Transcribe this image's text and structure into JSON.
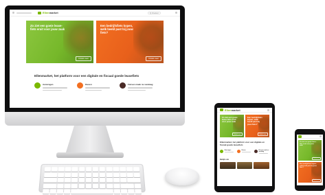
{
  "site": {
    "logo_prefix": "Ellen",
    "logo_suffix": "market",
    "search_placeholder": "Q Zoeken"
  },
  "hero": {
    "left_title": "Zo ziet een goeie lease-fiets eruit voor jouw zaak",
    "left_button": "Ontdek meer",
    "right_title": "Een bedrijfsfiets kopen, welk beeld past bij jouw fiets?",
    "right_button": "Ontdek meer"
  },
  "pitch": "Ellenmarket, het platform voor een digitale en fiscaal goede leasefiets",
  "features": [
    {
      "label": "Aanvragen",
      "icon": "leaf-icon",
      "color": "#7ab800"
    },
    {
      "label": "Kiezen",
      "icon": "bike-icon",
      "color": "#f26f21"
    },
    {
      "label": "Fietsen maak nu vandaag",
      "icon": "check-icon",
      "color": "#4a2a26"
    }
  ],
  "tablet_more": "Bekijk ook",
  "colors": {
    "green": "#7ab800",
    "orange": "#f26f21",
    "device": "#0e0e0f"
  }
}
